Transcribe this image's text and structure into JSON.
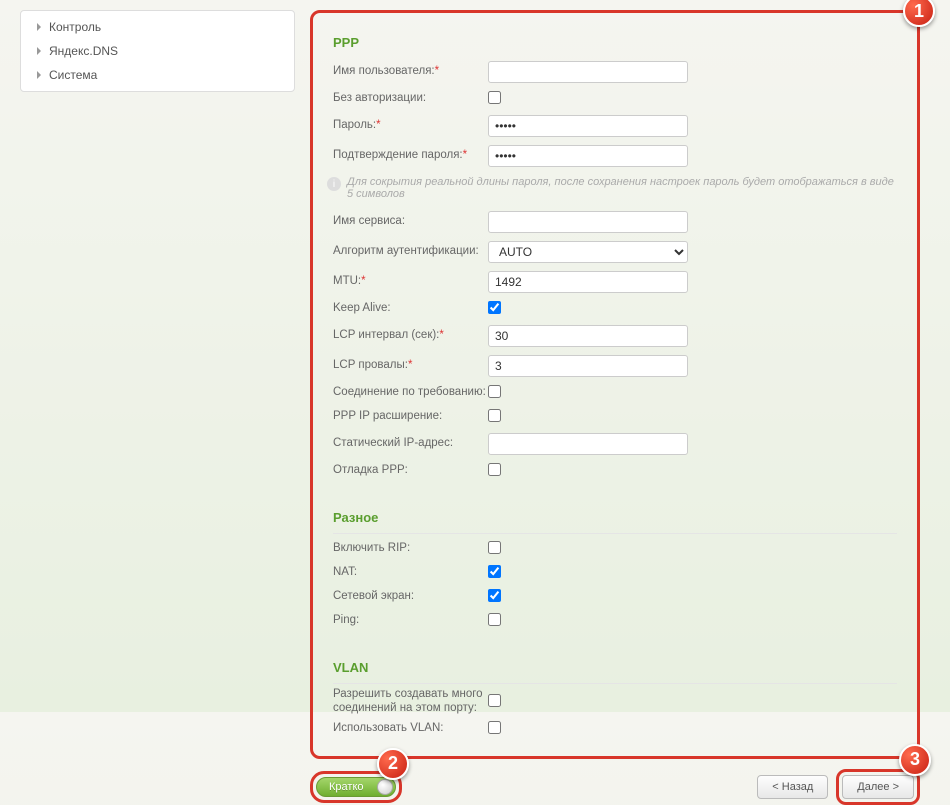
{
  "sidebar": {
    "items": [
      {
        "label": "Контроль"
      },
      {
        "label": "Яндекс.DNS"
      },
      {
        "label": "Система"
      }
    ]
  },
  "callouts": {
    "c1": "1",
    "c2": "2",
    "c3": "3"
  },
  "ppp": {
    "title": "PPP",
    "username_label": "Имя пользователя:",
    "username_value": "",
    "noauth_label": "Без авторизации:",
    "noauth_checked": false,
    "password_label": "Пароль:",
    "password_value": "•••••",
    "password_confirm_label": "Подтверждение пароля:",
    "password_confirm_value": "•••••",
    "hint": "Для сокрытия реальной длины пароля, после сохранения настроек пароль будет отображаться в виде 5 символов",
    "service_label": "Имя сервиса:",
    "service_value": "",
    "auth_algo_label": "Алгоритм аутентификации:",
    "auth_algo_value": "AUTO",
    "mtu_label": "MTU:",
    "mtu_value": "1492",
    "keepalive_label": "Keep Alive:",
    "keepalive_checked": true,
    "lcp_interval_label": "LCP интервал (сек):",
    "lcp_interval_value": "30",
    "lcp_fails_label": "LCP провалы:",
    "lcp_fails_value": "3",
    "dial_on_demand_label": "Соединение по требованию:",
    "dial_on_demand_checked": false,
    "ppp_ip_ext_label": "PPP IP расширение:",
    "ppp_ip_ext_checked": false,
    "static_ip_label": "Статический IP-адрес:",
    "static_ip_value": "",
    "debug_label": "Отладка PPP:",
    "debug_checked": false
  },
  "misc": {
    "title": "Разное",
    "rip_label": "Включить RIP:",
    "rip_checked": false,
    "nat_label": "NAT:",
    "nat_checked": true,
    "firewall_label": "Сетевой экран:",
    "firewall_checked": true,
    "ping_label": "Ping:",
    "ping_checked": false
  },
  "vlan": {
    "title": "VLAN",
    "multi_conn_label": "Разрешить создавать много соединений на этом порту:",
    "multi_conn_checked": false,
    "use_vlan_label": "Использовать VLAN:",
    "use_vlan_checked": false
  },
  "footer": {
    "toggle_label": "Кратко",
    "back_label": "< Назад",
    "next_label": "Далее >"
  }
}
